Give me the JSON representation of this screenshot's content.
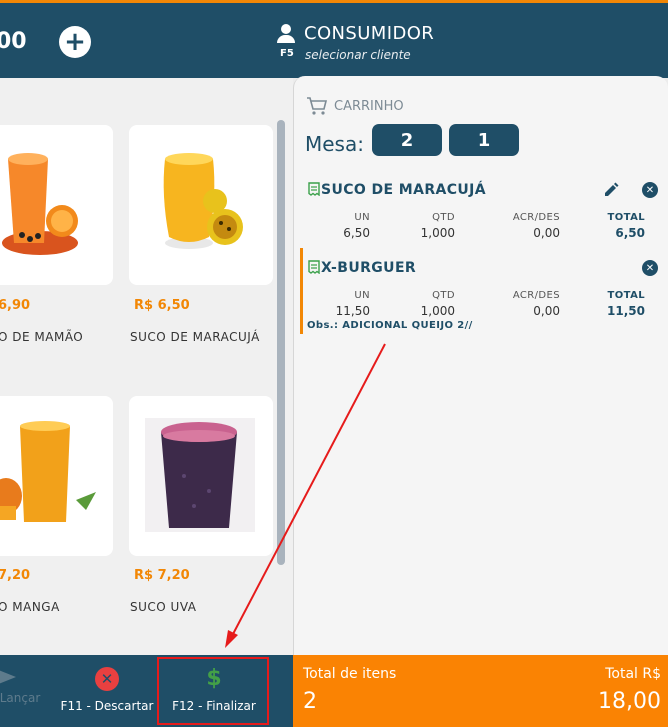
{
  "header": {
    "left_partial_value": "00",
    "add_label": "+",
    "customer_name": "CONSUMIDOR",
    "customer_shortcut": "F5",
    "customer_hint": "selecionar cliente"
  },
  "products": [
    {
      "price": "6,90",
      "name": "O DE MAMÃO"
    },
    {
      "price": "R$ 6,50",
      "name": "SUCO DE MARACUJÁ"
    },
    {
      "price": "7,20",
      "name": "O MANGA"
    },
    {
      "price": "R$ 7,20",
      "name": "SUCO UVA"
    }
  ],
  "cart": {
    "title": "CARRINHO",
    "mesa_label": "Mesa:",
    "mesa_values": [
      "2",
      "1"
    ],
    "columns": [
      "UN",
      "QTD",
      "ACR/DES",
      "TOTAL"
    ],
    "items": [
      {
        "name": "SUCO DE MARACUJÁ",
        "un": "6,50",
        "qtd": "1,000",
        "acr": "0,00",
        "total": "6,50"
      },
      {
        "name": "X-BURGUER",
        "un": "11,50",
        "qtd": "1,000",
        "acr": "0,00",
        "total": "11,50",
        "obs": "Obs.: ADICIONAL QUEIJO 2//"
      }
    ]
  },
  "actions": {
    "lancar": "Lançar",
    "descartar": "F11 - Descartar",
    "finalizar": "F12 - Finalizar"
  },
  "totals": {
    "items_label": "Total de itens",
    "items_value": "2",
    "value_label": "Total R$",
    "value": "18,00"
  },
  "colors": {
    "primary": "#1f4e67",
    "accent": "#fa8303",
    "highlight": "#e61b1b",
    "success": "#43a047"
  }
}
